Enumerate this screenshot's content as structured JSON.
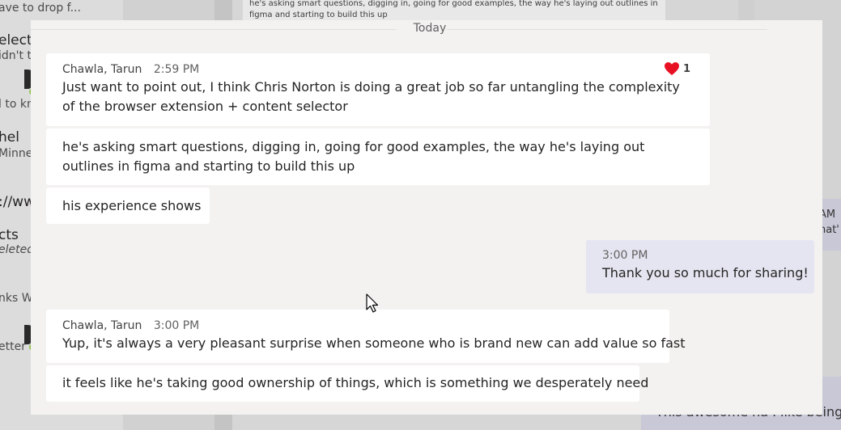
{
  "background": {
    "left_lines": [
      "ave to drop f...",
      "electo",
      "idn't t",
      "l to kn",
      "hel",
      "Minne",
      "://www",
      "cts",
      "eleted",
      "nks W",
      "etter th"
    ],
    "top_card": "he's asking smart questions, digging in, going for good examples, the way he's laying out outlines in figma and starting to build this up",
    "right_card_time": "AM",
    "right_card_text": "hat'",
    "bottom_card_text": "This awesome ha I like being a"
  },
  "chat": {
    "date_divider": "Today",
    "messages": [
      {
        "author": "Chawla, Tarun",
        "time": "2:59 PM",
        "body": "Just want to point out, I think Chris Norton is doing a great job so far untangling the complexity of the browser extension + content selector",
        "reaction_count": "1",
        "reaction_icon": "heart-icon"
      },
      {
        "body": "he's asking smart questions, digging in, going for good examples, the way he's laying out outlines in figma and starting to build this up"
      },
      {
        "body": "his experience shows"
      },
      {
        "time": "3:00 PM",
        "body": "Thank you so much for sharing!"
      },
      {
        "author": "Chawla, Tarun",
        "time": "3:00 PM",
        "body": "Yup, it's always a very pleasant surprise when someone who is brand new can add value so fast"
      },
      {
        "body": "it feels like he's taking good ownership of things, which is something we desperately need"
      }
    ]
  },
  "colors": {
    "panel_bg": "#f3f2f1",
    "bubble_other": "#ffffff",
    "bubble_mine": "#e5e5f1",
    "heart": "#e81123"
  }
}
